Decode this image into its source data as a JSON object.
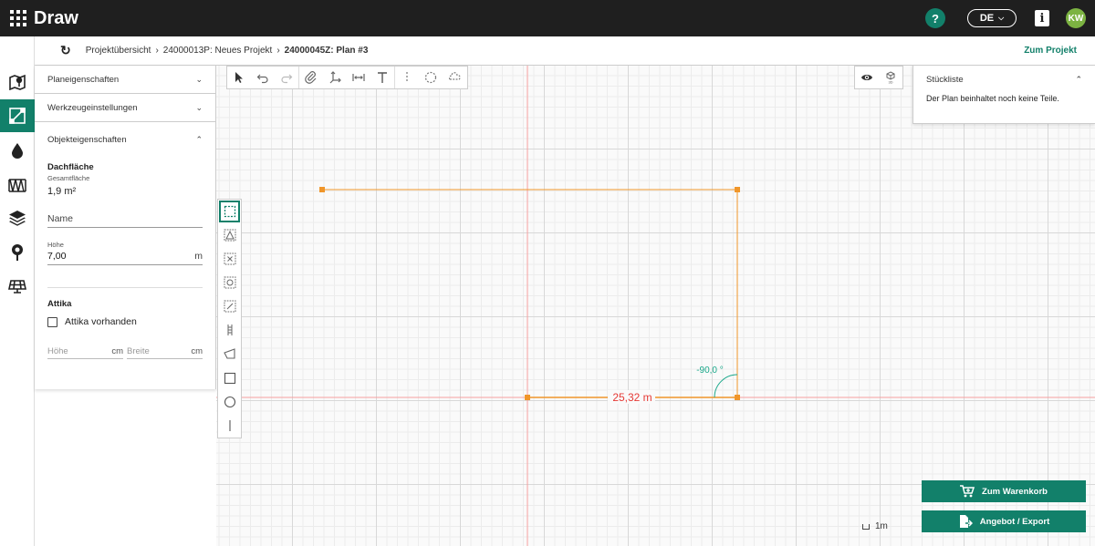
{
  "app": {
    "title": "Draw"
  },
  "topbar": {
    "help": "?",
    "language": "DE",
    "info": "i",
    "avatar_initials": "KW"
  },
  "breadcrumb": {
    "items": [
      "Projektübersicht",
      "24000013P: Neues Projekt",
      "24000045Z: Plan #3"
    ],
    "to_project": "Zum Projekt"
  },
  "left_panel": {
    "sections": [
      "Planeigenschaften",
      "Werkzeugeinstellungen",
      "Objekteigenschaften"
    ],
    "object": {
      "title": "Dachfläche",
      "area_label": "Gesamtfläche",
      "area_value": "1,9 m²",
      "name_placeholder": "Name",
      "height_label": "Höhe",
      "height_value": "7,00",
      "height_unit": "m",
      "attika_title": "Attika",
      "attika_checkbox": "Attika vorhanden",
      "attika_height_placeholder": "Höhe",
      "attika_height_unit": "cm",
      "attika_width_placeholder": "Breite",
      "attika_width_unit": "cm"
    }
  },
  "parts_list": {
    "title": "Stückliste",
    "message": "Der Plan beinhaltet noch keine Teile."
  },
  "canvas": {
    "dimension_label": "25,32 m",
    "angle_label": "-90,0 °",
    "scale_label": "1m",
    "colors": {
      "shape": "#f0962a",
      "guide": "#f08080",
      "dimension": "#e53935",
      "angle": "#1aa88a"
    }
  },
  "buttons": {
    "cart": "Zum Warenkorb",
    "export": "Angebot / Export"
  },
  "accent_color": "#12806a"
}
